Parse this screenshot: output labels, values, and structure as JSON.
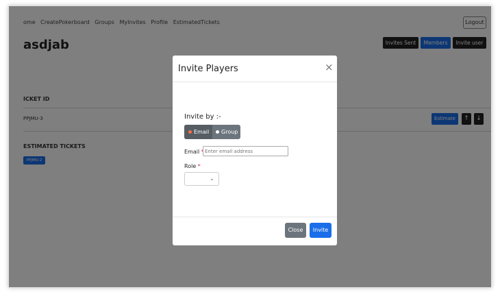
{
  "navbar": {
    "links": [
      "ome",
      "CreatePokerboard",
      "Groups",
      "MyInvites",
      "Profile",
      "EstimatedTickets"
    ],
    "logout_label": "Logout"
  },
  "page": {
    "title": "asdjab",
    "buttons": {
      "invites_sent": "Invites Sent",
      "members": "Members",
      "invite_user": "Invite user"
    },
    "ticket_section": {
      "heading": "ICKET ID",
      "ticket_id": "PPJMU-3",
      "estimate_label": "Estimate",
      "up_arrow": "↑",
      "down_arrow": "↓"
    },
    "estimated_section": {
      "heading": "ESTIMATED TICKETS",
      "badge": "PPJMU-2"
    }
  },
  "modal": {
    "title": "Invite Players",
    "close_glyph": "×",
    "invite_by_label": "Invite by :-",
    "options": [
      "Email",
      "Group"
    ],
    "selected_option": "Email",
    "email_label": "Email",
    "email_placeholder": "Enter email address",
    "email_value": "",
    "role_label": "Role",
    "role_value": "",
    "required_mark": "*",
    "chevron_glyph": "⌄",
    "close_button": "Close",
    "invite_button": "Invite"
  },
  "colors": {
    "primary": "#1a6ee8",
    "secondary": "#6c757d",
    "dark": "#222222",
    "required": "#d9304a",
    "radio_active": "#ff7043"
  }
}
